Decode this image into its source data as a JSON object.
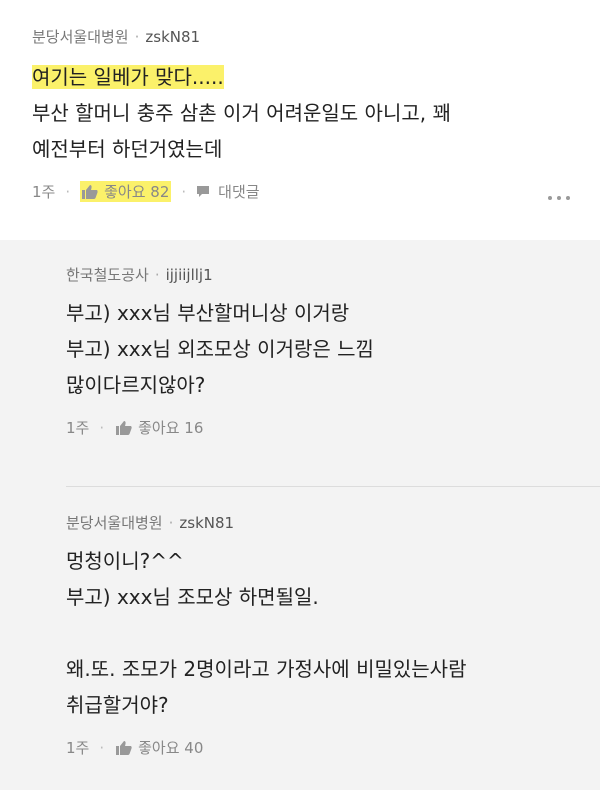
{
  "comment": {
    "author": "분당서울대병원",
    "user_id": "zskN81",
    "text_highlight": "여기는 일베가 맞다.....",
    "text_rest": "부산 할머니 충주 삼촌 이거 어려운일도 아니고, 꽤\n예전부터 하던거였는데",
    "time": "1주",
    "likes": "좋아요 82",
    "reply_label": "대댓글"
  },
  "replies": [
    {
      "author": "한국철도공사",
      "user_id": "ijjiijllj1",
      "text": "부고) xxx님 부산할머니상 이거랑\n부고) xxx님 외조모상 이거랑은 느낌\n많이다르지않아?",
      "time": "1주",
      "likes": "좋아요 16"
    },
    {
      "author": "분당서울대병원",
      "user_id": "zskN81",
      "text": "멍청이니?^^\n부고) xxx님 조모상 하면될일.\n\n왜.또. 조모가 2명이라고 가정사에 비밀있는사람\n취급할거야?",
      "time": "1주",
      "likes": "좋아요 40"
    }
  ],
  "colors": {
    "highlight": "#fbf16a",
    "thread_bg": "#f3f3f3"
  }
}
